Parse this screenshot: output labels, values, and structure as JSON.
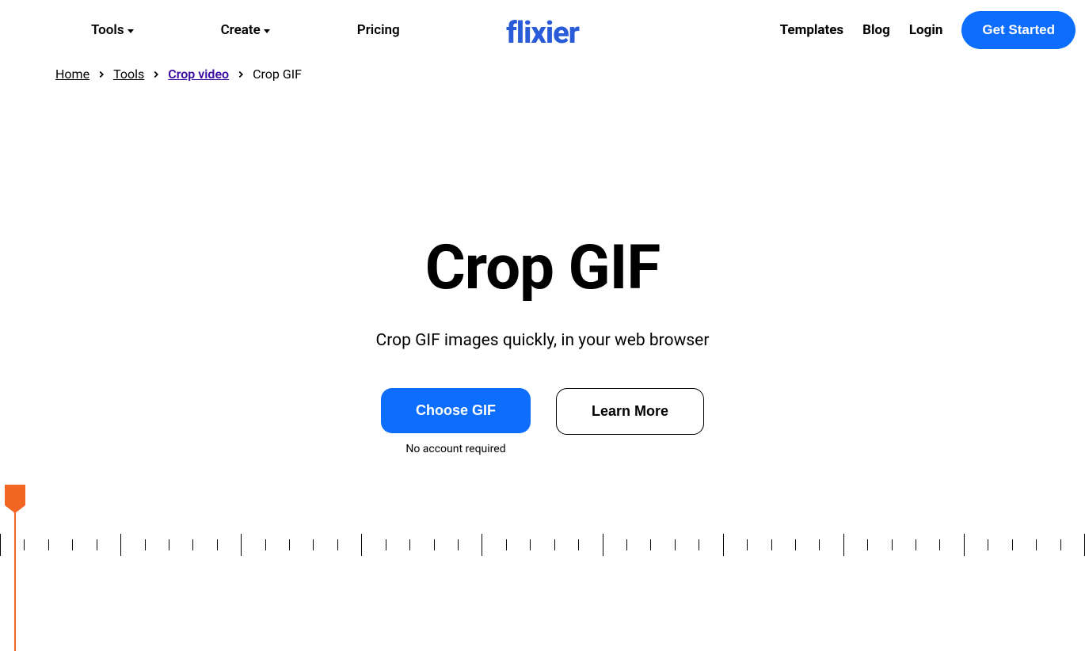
{
  "header": {
    "nav_left": {
      "tools": "Tools",
      "create": "Create",
      "pricing": "Pricing"
    },
    "logo": "flixier",
    "nav_right": {
      "templates": "Templates",
      "blog": "Blog",
      "login": "Login",
      "get_started": "Get Started"
    }
  },
  "breadcrumbs": {
    "home": "Home",
    "tools": "Tools",
    "crop_video": "Crop video",
    "current": "Crop GIF"
  },
  "hero": {
    "title": "Crop GIF",
    "subtitle": "Crop GIF images quickly, in your web browser",
    "choose_gif": "Choose GIF",
    "no_account": "No account required",
    "learn_more": "Learn More"
  }
}
